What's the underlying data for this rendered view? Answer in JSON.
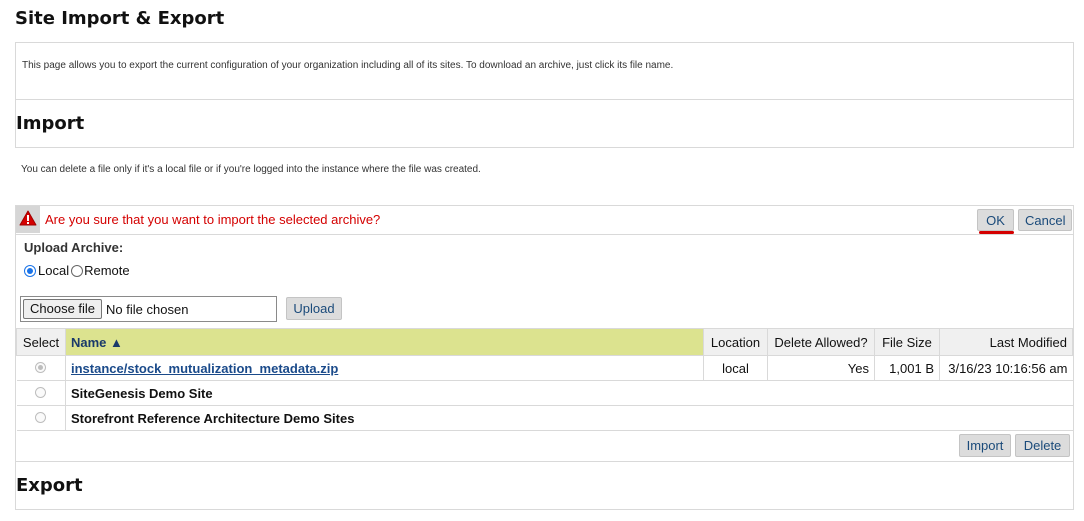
{
  "page": {
    "title": "Site Import & Export",
    "intro": "This page allows you to export the current configuration of your organization including all of its sites. To download an archive, just click its file name."
  },
  "import": {
    "title": "Import",
    "note": "You can delete a file only if it's a local file or if you're logged into the instance where the file was created.",
    "confirm": {
      "message": "Are you sure that you want to import the selected archive?",
      "ok_label": "OK",
      "cancel_label": "Cancel"
    },
    "upload": {
      "label": "Upload Archive:",
      "options": [
        "Local",
        "Remote"
      ],
      "selected": "Local",
      "choose_file_label": "Choose file",
      "no_file_text": "No file chosen",
      "upload_label": "Upload"
    },
    "table": {
      "columns": [
        "Select",
        "Name ▲",
        "Location",
        "Delete Allowed?",
        "File Size",
        "Last Modified"
      ],
      "rows": [
        {
          "name": "instance/stock_mutualization_metadata.zip",
          "location": "local",
          "delete_allowed": "Yes",
          "file_size": "1,001 B",
          "last_modified": "3/16/23 10:16:56 am",
          "selected": true
        },
        {
          "name": "SiteGenesis Demo Site",
          "location": "",
          "delete_allowed": "",
          "file_size": "",
          "last_modified": "",
          "selected": false
        },
        {
          "name": "Storefront Reference Architecture Demo Sites",
          "location": "",
          "delete_allowed": "",
          "file_size": "",
          "last_modified": "",
          "selected": false
        }
      ]
    },
    "import_label": "Import",
    "delete_label": "Delete"
  },
  "export": {
    "title": "Export"
  },
  "colors": {
    "warning_text": "#d40000",
    "header_highlight": "#dce38f",
    "link": "#1a4a8a"
  }
}
